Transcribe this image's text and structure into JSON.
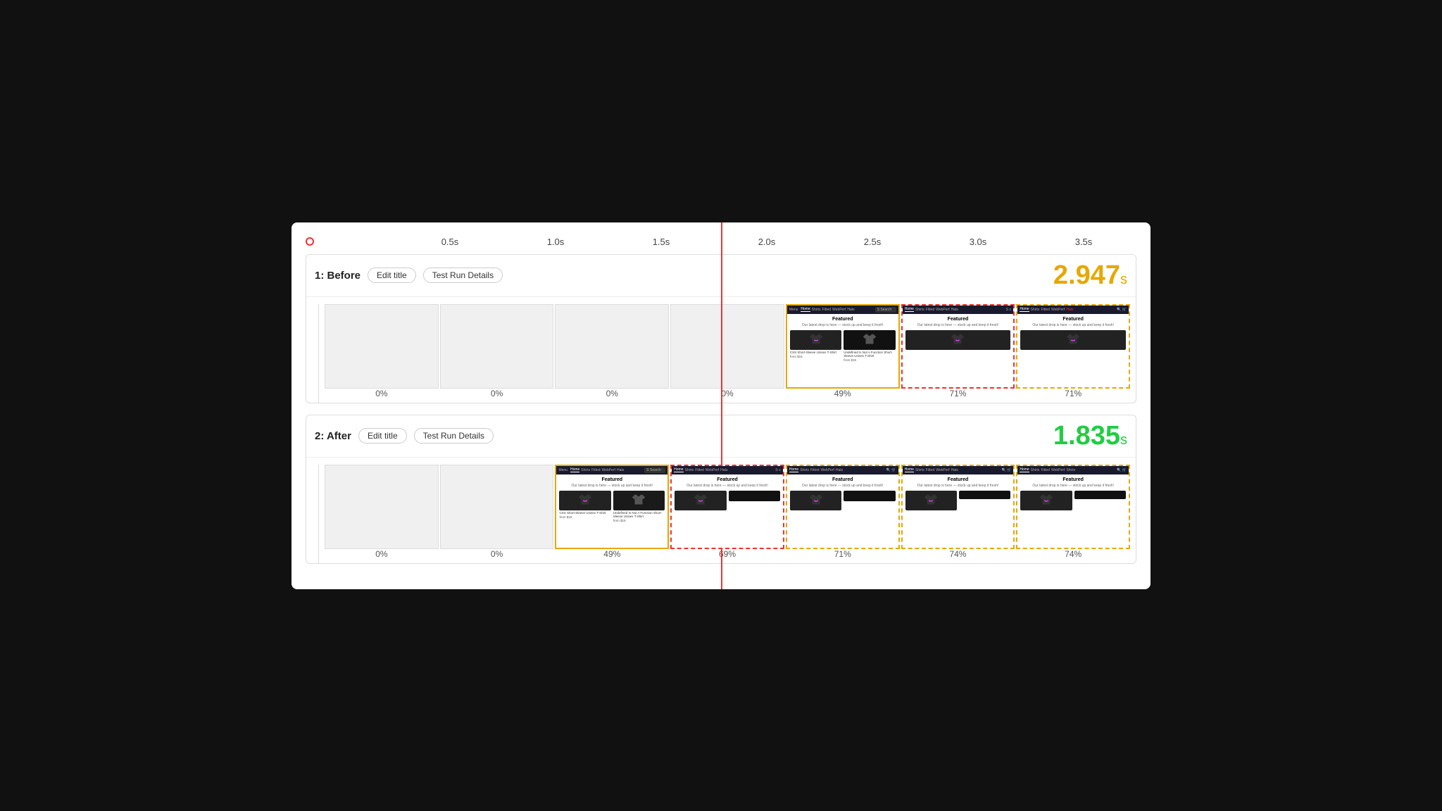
{
  "timeline": {
    "ticks": [
      "0.5s",
      "1.0s",
      "1.5s",
      "2.0s",
      "2.5s",
      "3.0s",
      "3.5s"
    ]
  },
  "before": {
    "label": "1: Before",
    "edit_title": "Edit title",
    "test_run": "Test Run Details",
    "score": "2.947",
    "score_unit": "s",
    "score_class": "score-before",
    "frames": [
      {
        "pct": "0%",
        "type": "blank"
      },
      {
        "pct": "0%",
        "type": "blank"
      },
      {
        "pct": "0%",
        "type": "blank"
      },
      {
        "pct": "0%",
        "type": "blank"
      },
      {
        "pct": "49%",
        "type": "browser-partial",
        "border": "active-gold"
      },
      {
        "pct": "71%",
        "type": "browser-full",
        "border": "active-red"
      },
      {
        "pct": "71%",
        "type": "browser-full",
        "border": "active-orange"
      }
    ]
  },
  "after": {
    "label": "2: After",
    "edit_title": "Edit title",
    "test_run": "Test Run Details",
    "score": "1.835",
    "score_unit": "s",
    "score_class": "score-after",
    "frames": [
      {
        "pct": "0%",
        "type": "blank"
      },
      {
        "pct": "0%",
        "type": "blank"
      },
      {
        "pct": "49%",
        "type": "browser-partial",
        "border": "active-gold"
      },
      {
        "pct": "69%",
        "type": "browser-full",
        "border": "active-red"
      },
      {
        "pct": "71%",
        "type": "browser-full",
        "border": "active-orange"
      },
      {
        "pct": "74%",
        "type": "browser-full",
        "border": "active-orange"
      },
      {
        "pct": "74%",
        "type": "browser-full",
        "border": "active-orange"
      }
    ]
  },
  "buttons": {
    "edit_title": "Edit title",
    "test_run": "Test Run Details"
  }
}
